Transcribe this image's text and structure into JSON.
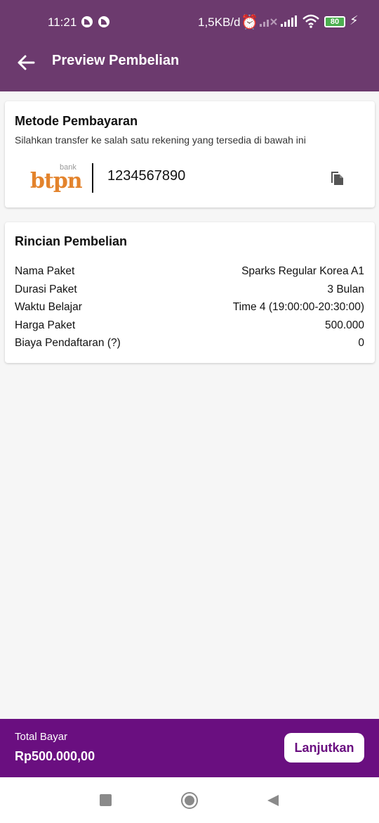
{
  "status_bar": {
    "time": "11:21",
    "network_speed": "1,5KB/d",
    "battery": "80"
  },
  "app_bar": {
    "title": "Preview Pembelian",
    "back_icon": "arrow-left-icon"
  },
  "payment": {
    "title": "Metode Pembayaran",
    "subtitle": "Silahkan transfer ke salah satu rekening yang tersedia di bawah ini",
    "bank_logo_small": "bank",
    "bank_logo_name": "btpn",
    "account_number": "1234567890",
    "copy_icon": "copy-icon"
  },
  "details": {
    "title": "Rincian Pembelian",
    "rows": [
      {
        "label": "Nama Paket",
        "value": "Sparks Regular Korea A1"
      },
      {
        "label": "Durasi Paket",
        "value": "3 Bulan"
      },
      {
        "label": "Waktu Belajar",
        "value": "Time 4 (19:00:00-20:30:00)"
      },
      {
        "label": "Harga Paket",
        "value": "500.000"
      },
      {
        "label": "Biaya Pendaftaran (?)",
        "value": "0"
      }
    ]
  },
  "footer": {
    "total_label": "Total Bayar",
    "total_value": "Rp500.000,00",
    "next_button": "Lanjutkan"
  },
  "colors": {
    "app_bar": "#6c3a6e",
    "bottom_bar": "#6a0f80",
    "bank_logo": "#e3832c"
  }
}
